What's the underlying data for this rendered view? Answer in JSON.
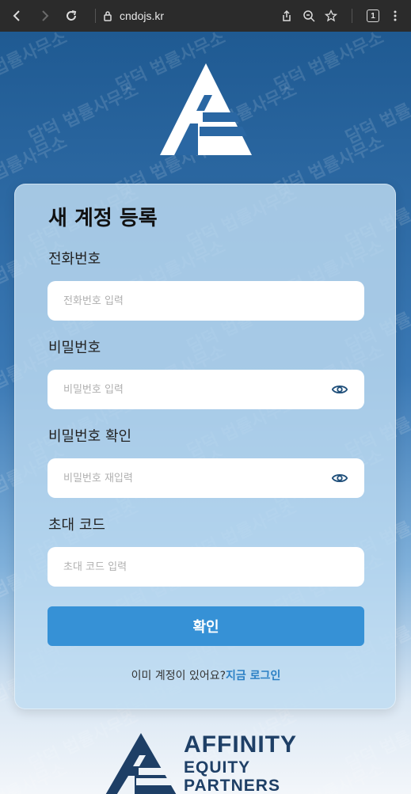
{
  "browser": {
    "url": "cndojs.kr",
    "tab_count": "1"
  },
  "form": {
    "title": "새 계정 등록",
    "phone": {
      "label": "전화번호",
      "placeholder": "전화번호 입력"
    },
    "password": {
      "label": "비밀번호",
      "placeholder": "비밀번호 입력"
    },
    "password_confirm": {
      "label": "비밀번호 확인",
      "placeholder": "비밀번호 재입력"
    },
    "invite_code": {
      "label": "초대 코드",
      "placeholder": "초대 코드 입력"
    },
    "submit_label": "확인",
    "signin_prompt": "이미 계정이 있어요?",
    "signin_link": "지금 로그인"
  },
  "brand": {
    "line1": "AFFINITY",
    "line2": "EQUITY",
    "line3": "PARTNERS"
  },
  "watermark": {
    "text": "담덕 법률사무소"
  },
  "colors": {
    "accent": "#3691d6",
    "link": "#2a7fc4",
    "brand_navy": "#1e3f66"
  }
}
